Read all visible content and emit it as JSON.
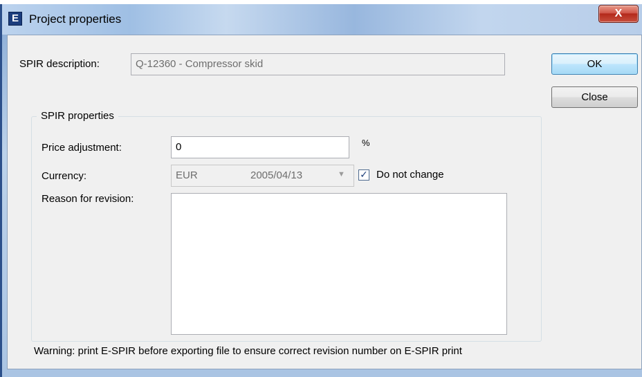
{
  "window": {
    "title": "Project properties",
    "app_icon_glyph": "E",
    "close_glyph": "X"
  },
  "form": {
    "spir_description_label": "SPIR description:",
    "spir_description_value": "Q-12360 - Compressor skid",
    "group_title": "SPIR properties",
    "price_adjustment_label": "Price adjustment:",
    "price_adjustment_value": "0",
    "percent_unit": "%",
    "currency_label": "Currency:",
    "currency_value": "EUR",
    "currency_date": "2005/04/13",
    "do_not_change_label": "Do not change",
    "do_not_change_checked": true,
    "reason_label": "Reason for revision:",
    "reason_value": "",
    "warning": "Warning: print E-SPIR before exporting file to ensure correct revision number on E-SPIR print"
  },
  "buttons": {
    "ok": "OK",
    "close": "Close"
  },
  "icons": {
    "app": "app-logo-icon",
    "close": "close-icon",
    "dropdown": "chevron-down-icon",
    "checkmark": "checkmark-icon"
  },
  "colors": {
    "title_bar": "#9fbfe4",
    "close_button": "#c8503f",
    "dialog_bg": "#f0f0f0",
    "ok_border": "#3c7fb1"
  }
}
